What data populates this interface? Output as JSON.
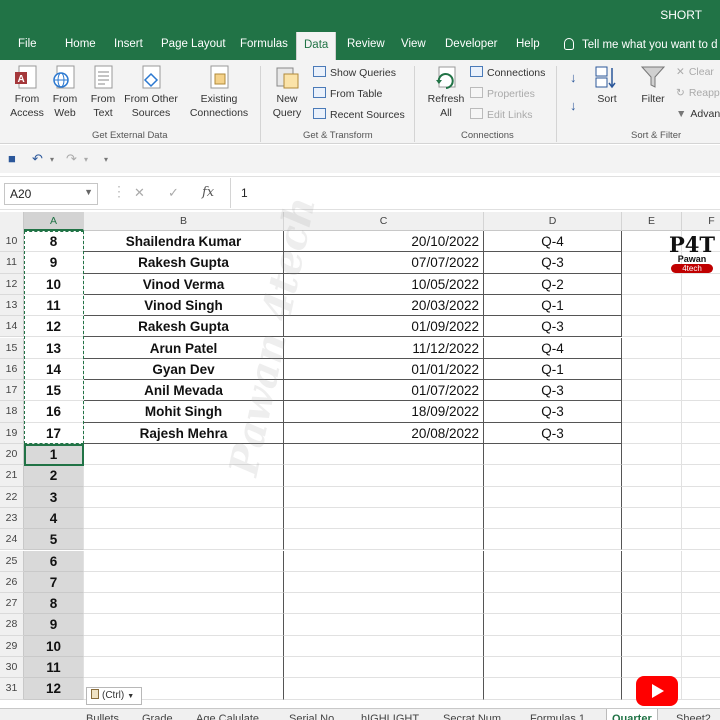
{
  "app": {
    "title": "SHORT"
  },
  "ribbon_tabs": [
    {
      "label": "File"
    },
    {
      "label": "Home"
    },
    {
      "label": "Insert"
    },
    {
      "label": "Page Layout"
    },
    {
      "label": "Formulas"
    },
    {
      "label": "Data"
    },
    {
      "label": "Review"
    },
    {
      "label": "View"
    },
    {
      "label": "Developer"
    },
    {
      "label": "Help"
    }
  ],
  "active_tab": "Data",
  "tell_me": "Tell me what you want to d",
  "ribbon": {
    "get_external": {
      "group_label": "Get External Data",
      "from_access": "From\nAccess",
      "from_web": "From\nWeb",
      "from_text": "From\nText",
      "from_other": "From Other\nSources",
      "existing": "Existing\nConnections"
    },
    "get_transform": {
      "group_label": "Get & Transform",
      "new_query": "New\nQuery",
      "show_queries": "Show Queries",
      "from_table": "From Table",
      "recent_sources": "Recent Sources"
    },
    "connections": {
      "group_label": "Connections",
      "refresh_all": "Refresh\nAll",
      "connections": "Connections",
      "properties": "Properties",
      "edit_links": "Edit Links"
    },
    "sort_filter": {
      "group_label": "Sort & Filter",
      "sort": "Sort",
      "filter": "Filter",
      "clear": "Clear",
      "reapply": "Reapp",
      "advanced": "Advan"
    }
  },
  "formula_bar": {
    "name_box": "A20",
    "formula": "1"
  },
  "columns": [
    "A",
    "B",
    "C",
    "D",
    "E",
    "F"
  ],
  "selected_column": "A",
  "rows": [
    {
      "num": "10",
      "a": "8",
      "b": "Shailendra Kumar",
      "c": "20/10/2022",
      "d": "Q-4"
    },
    {
      "num": "11",
      "a": "9",
      "b": "Rakesh Gupta",
      "c": "07/07/2022",
      "d": "Q-3"
    },
    {
      "num": "12",
      "a": "10",
      "b": "Vinod Verma",
      "c": "10/05/2022",
      "d": "Q-2"
    },
    {
      "num": "13",
      "a": "11",
      "b": "Vinod Singh",
      "c": "20/03/2022",
      "d": "Q-1"
    },
    {
      "num": "14",
      "a": "12",
      "b": "Rakesh Gupta",
      "c": "01/09/2022",
      "d": "Q-3"
    },
    {
      "num": "15",
      "a": "13",
      "b": "Arun Patel",
      "c": "11/12/2022",
      "d": "Q-4"
    },
    {
      "num": "16",
      "a": "14",
      "b": "Gyan Dev",
      "c": "01/01/2022",
      "d": "Q-1"
    },
    {
      "num": "17",
      "a": "15",
      "b": "Anil Mevada",
      "c": "01/07/2022",
      "d": "Q-3"
    },
    {
      "num": "18",
      "a": "16",
      "b": "Mohit Singh",
      "c": "18/09/2022",
      "d": "Q-3"
    },
    {
      "num": "19",
      "a": "17",
      "b": "Rajesh Mehra",
      "c": "20/08/2022",
      "d": "Q-3"
    },
    {
      "num": "20",
      "a": "1",
      "b": "",
      "c": "",
      "d": ""
    },
    {
      "num": "21",
      "a": "2",
      "b": "",
      "c": "",
      "d": ""
    },
    {
      "num": "22",
      "a": "3",
      "b": "",
      "c": "",
      "d": ""
    },
    {
      "num": "23",
      "a": "4",
      "b": "",
      "c": "",
      "d": ""
    },
    {
      "num": "24",
      "a": "5",
      "b": "",
      "c": "",
      "d": ""
    },
    {
      "num": "25",
      "a": "6",
      "b": "",
      "c": "",
      "d": ""
    },
    {
      "num": "26",
      "a": "7",
      "b": "",
      "c": "",
      "d": ""
    },
    {
      "num": "27",
      "a": "8",
      "b": "",
      "c": "",
      "d": ""
    },
    {
      "num": "28",
      "a": "9",
      "b": "",
      "c": "",
      "d": ""
    },
    {
      "num": "29",
      "a": "10",
      "b": "",
      "c": "",
      "d": ""
    },
    {
      "num": "30",
      "a": "11",
      "b": "",
      "c": "",
      "d": ""
    },
    {
      "num": "31",
      "a": "12",
      "b": "",
      "c": "",
      "d": ""
    }
  ],
  "watermark": "Pawan 4tech",
  "logo": {
    "big": "P4T",
    "small": "Pawan",
    "bar": "4tech"
  },
  "paste_options": "(Ctrl)",
  "sheet_tabs": [
    {
      "label": "Bullets"
    },
    {
      "label": "Grade"
    },
    {
      "label": "Age Calulate"
    },
    {
      "label": "Serial No"
    },
    {
      "label": "hIGHLIGHT"
    },
    {
      "label": "Secrat Num"
    },
    {
      "label": "Formulas 1"
    },
    {
      "label": "Quarter"
    },
    {
      "label": "Sheet2"
    }
  ],
  "active_sheet": "Quarter",
  "colors": {
    "accent": "#217346",
    "youtube": "#ff0000",
    "logo_red": "#c00000"
  }
}
